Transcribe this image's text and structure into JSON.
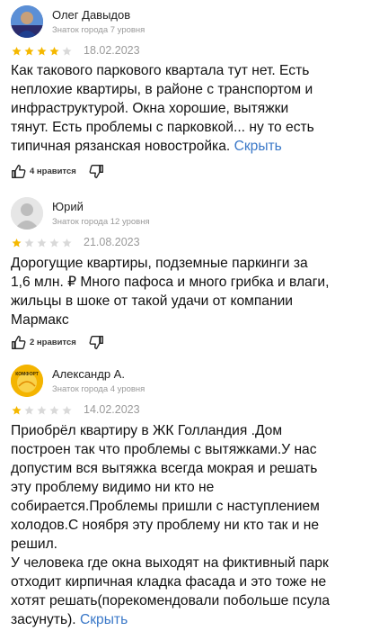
{
  "reviews": [
    {
      "author": "Олег Давыдов",
      "level": "Знаток города 7 уровня",
      "rating": 4,
      "date": "18.02.2023",
      "text": "Как такового паркового квартала тут нет. Есть\nнеплохие квартиры, в районе с транспортом и\nинфраструктурой. Окна хорошие, вытяжки\nтянут. Есть проблемы с парковкой... ну то есть\nтипичная рязанская новостройка.",
      "hide_label": "Скрыть",
      "likes": "4 нравится"
    },
    {
      "author": "Юрий",
      "level": "Знаток города 12 уровня",
      "rating": 1,
      "date": "21.08.2023",
      "text": "Дорогущие квартиры, подземные паркинги за\n1,6 млн. ₽ Много пафоса и много грибка и влаги,\nжильцы в шоке от такой удачи от компании\nМармакс",
      "likes": "2 нравится"
    },
    {
      "author": "Александр А.",
      "level": "Знаток города 4 уровня",
      "avatar_text": "КОМФОРТ",
      "rating": 1,
      "date": "14.02.2023",
      "text": "Приобрёл квартиру в ЖК Голландия .Дом\nпостроен так что проблемы с вытяжками.У нас\nдопустим вся вытяжка всегда мокрая и решать\nэту проблему видимо ни кто не\nсобирается.Проблемы пришли с наступлением\nхолодов.С ноября эту проблему ни кто так и не\nрешил.\nУ человека где окна выходят на фиктивный парк\nотходит кирпичная кладка фасада и это тоже не\nхотят решать(порекомендовали побольше псула\nзасунуть).",
      "hide_label": "Скрыть"
    }
  ],
  "colors": {
    "star_filled": "#f5b800",
    "star_empty": "#d9d9d9",
    "link": "#3a78c8"
  }
}
